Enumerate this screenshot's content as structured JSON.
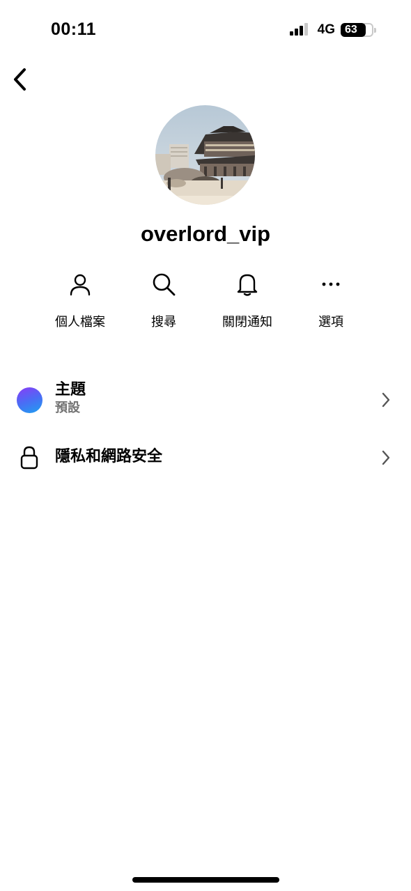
{
  "status_bar": {
    "time": "00:11",
    "network": "4G",
    "battery": "63"
  },
  "profile": {
    "username": "overlord_vip"
  },
  "actions": [
    {
      "label": "個人檔案",
      "icon": "person-icon"
    },
    {
      "label": "搜尋",
      "icon": "search-icon"
    },
    {
      "label": "關閉通知",
      "icon": "bell-icon"
    },
    {
      "label": "選項",
      "icon": "more-icon"
    }
  ],
  "settings": {
    "theme": {
      "title": "主題",
      "subtitle": "預設",
      "colors": [
        "#8a3cf6",
        "#4b6cf5",
        "#1ea0f0"
      ]
    },
    "privacy": {
      "title": "隱私和網路安全"
    }
  }
}
